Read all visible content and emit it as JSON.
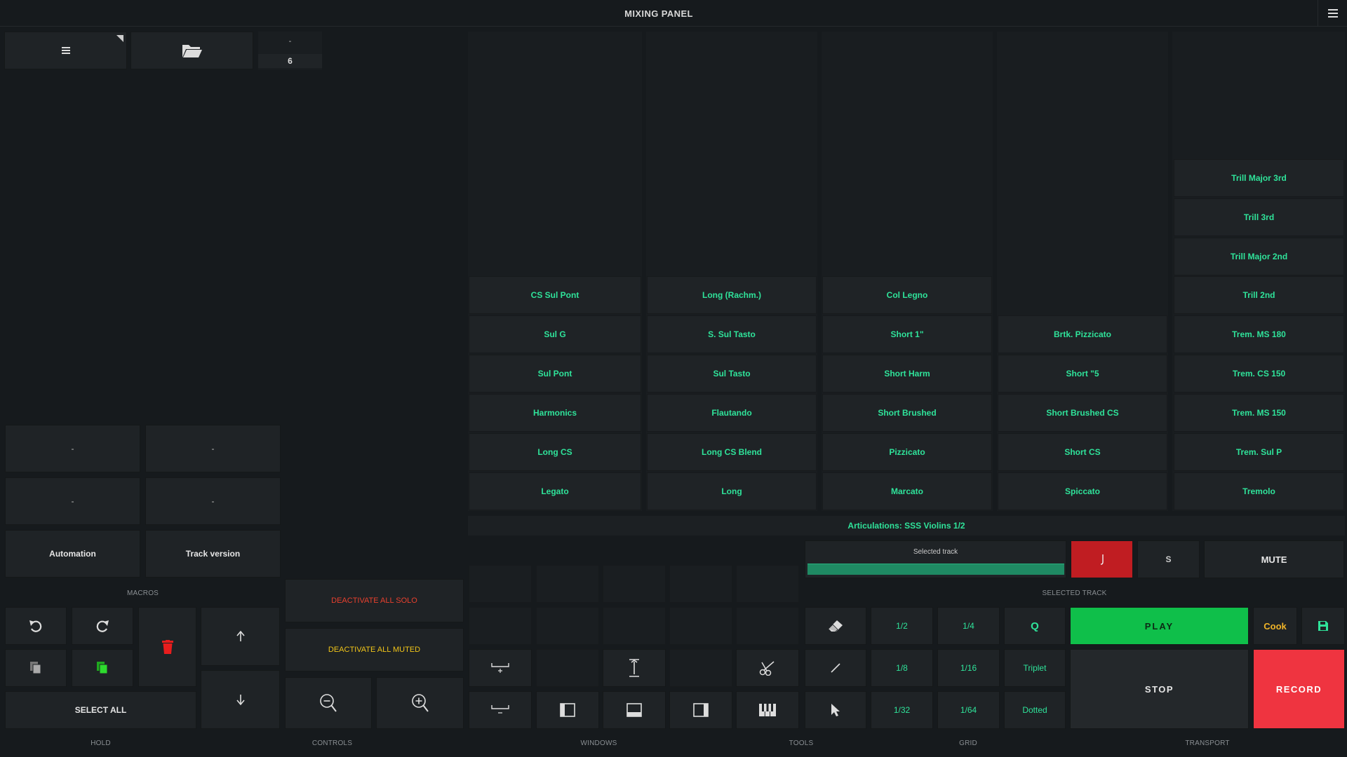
{
  "header": {
    "title": "MIXING PANEL"
  },
  "topbar": {
    "counter_top": "-",
    "counter_value": "6"
  },
  "articulation_columns": [
    [
      "CS Sul Pont",
      "Sul G",
      "Sul Pont",
      "Harmonics",
      "Long CS",
      "Legato"
    ],
    [
      "Long (Rachm.)",
      "S. Sul Tasto",
      "Sul Tasto",
      "Flautando",
      "Long CS Blend",
      "Long"
    ],
    [
      "Col Legno",
      "Short 1\"",
      "Short Harm",
      "Short Brushed",
      "Pizzicato",
      "Marcato"
    ],
    [
      "Brtk. Pizzicato",
      "Short \"5",
      "Short Brushed CS",
      "Short CS",
      "Spiccato"
    ],
    [
      "Trill Major 3rd",
      "Trill 3rd",
      "Trill Major 2nd",
      "Trill 2nd",
      "Trem. MS 180",
      "Trem. CS 150",
      "Trem. MS 150",
      "Trem. Sul P",
      "Tremolo"
    ]
  ],
  "articulations_bar": "Articulations: SSS Violins 1/2",
  "macros": {
    "slots": [
      "-",
      "-",
      "-",
      "-"
    ],
    "automation": "Automation",
    "track_version": "Track version",
    "label": "MACROS"
  },
  "controls": {
    "deactivate_solo": "DEACTIVATE ALL SOLO",
    "deactivate_muted": "DEACTIVATE ALL MUTED",
    "select_all": "SELECT ALL"
  },
  "selected_track": {
    "label": "Selected track",
    "section_label": "SELECTED TRACK",
    "solo": "S",
    "mute": "MUTE",
    "record_arm_icon": "note-icon"
  },
  "grid": {
    "row1": [
      "1/2",
      "1/4",
      "Q"
    ],
    "row2": [
      "1/8",
      "1/16",
      "Triplet"
    ],
    "row3": [
      "1/32",
      "1/64",
      "Dotted"
    ]
  },
  "transport": {
    "play": "PLAY",
    "cook": "Cook",
    "stop": "STOP",
    "record": "RECORD"
  },
  "footer_labels": {
    "hold": "HOLD",
    "controls": "CONTROLS",
    "windows": "WINDOWS",
    "tools": "TOOLS",
    "grid": "GRID",
    "transport": "TRANSPORT"
  },
  "colors": {
    "accent_green": "#2fe39a",
    "play_green": "#0fbf4a",
    "record_red": "#ef3440",
    "arm_red": "#c01d22",
    "solo_text": "#e8402e",
    "muted_text": "#f0c419",
    "cook_text": "#f0b428"
  }
}
